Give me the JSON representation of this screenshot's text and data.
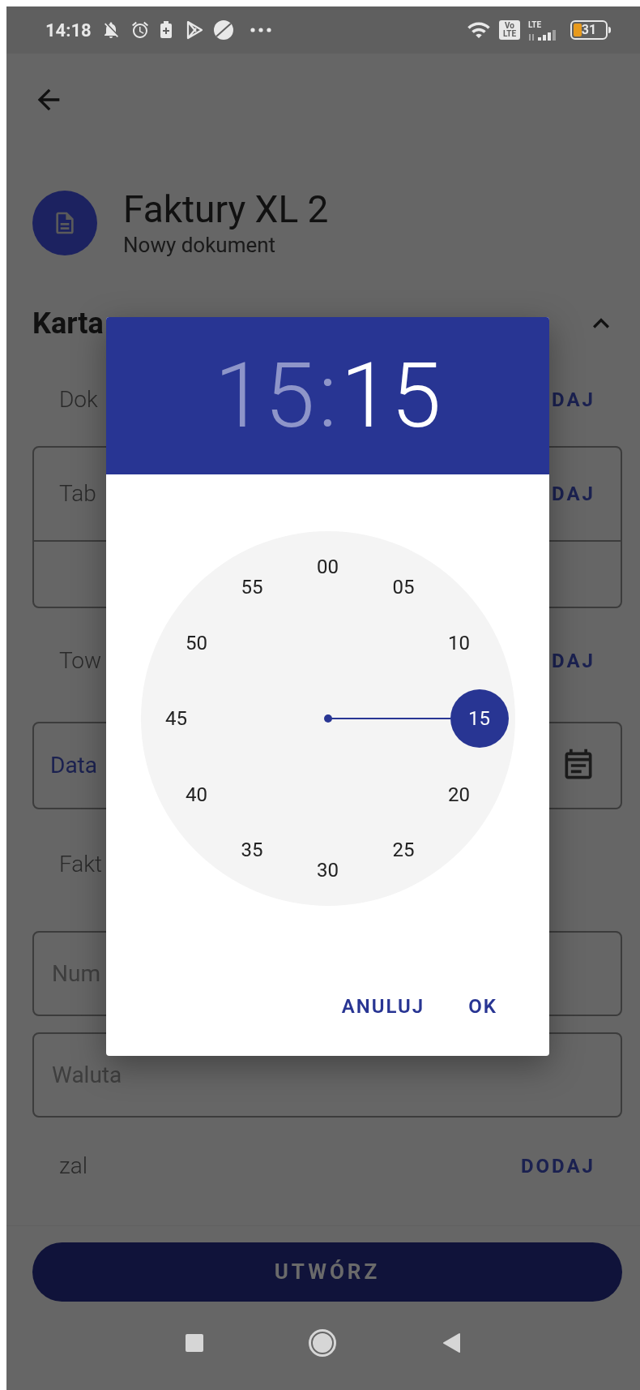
{
  "status_bar": {
    "time": "14:18",
    "volte": [
      "Vo",
      "LTE"
    ],
    "network": "LTE",
    "battery": "31"
  },
  "page": {
    "title": "Faktury XL 2",
    "subtitle": "Nowy dokument",
    "section": {
      "title": "Karta",
      "expanded": true
    },
    "rows": [
      {
        "kind": "action",
        "label": "Dok",
        "action": "DAJ"
      },
      {
        "kind": "table",
        "label": "Tab",
        "action": "DAJ"
      },
      {
        "kind": "action",
        "label": "Tow",
        "action": "DAJ"
      },
      {
        "kind": "date_field",
        "label": "Data"
      },
      {
        "kind": "heading",
        "label": "Fakt"
      },
      {
        "kind": "field",
        "placeholder": "Num"
      },
      {
        "kind": "field",
        "placeholder": "Waluta"
      },
      {
        "kind": "action",
        "label": "zal",
        "action": "DODAJ"
      }
    ],
    "create_button": "UTWÓRZ"
  },
  "time_picker": {
    "hour": "15",
    "separator": ":",
    "minute": "15",
    "hour_selected": false,
    "minute_selected": true,
    "dial": [
      {
        "label": "00",
        "selected": false
      },
      {
        "label": "05",
        "selected": false
      },
      {
        "label": "10",
        "selected": false
      },
      {
        "label": "15",
        "selected": true
      },
      {
        "label": "20",
        "selected": false
      },
      {
        "label": "25",
        "selected": false
      },
      {
        "label": "30",
        "selected": false
      },
      {
        "label": "35",
        "selected": false
      },
      {
        "label": "40",
        "selected": false
      },
      {
        "label": "45",
        "selected": false
      },
      {
        "label": "50",
        "selected": false
      },
      {
        "label": "55",
        "selected": false
      }
    ],
    "buttons": [
      "ANULUJ",
      "OK"
    ]
  }
}
